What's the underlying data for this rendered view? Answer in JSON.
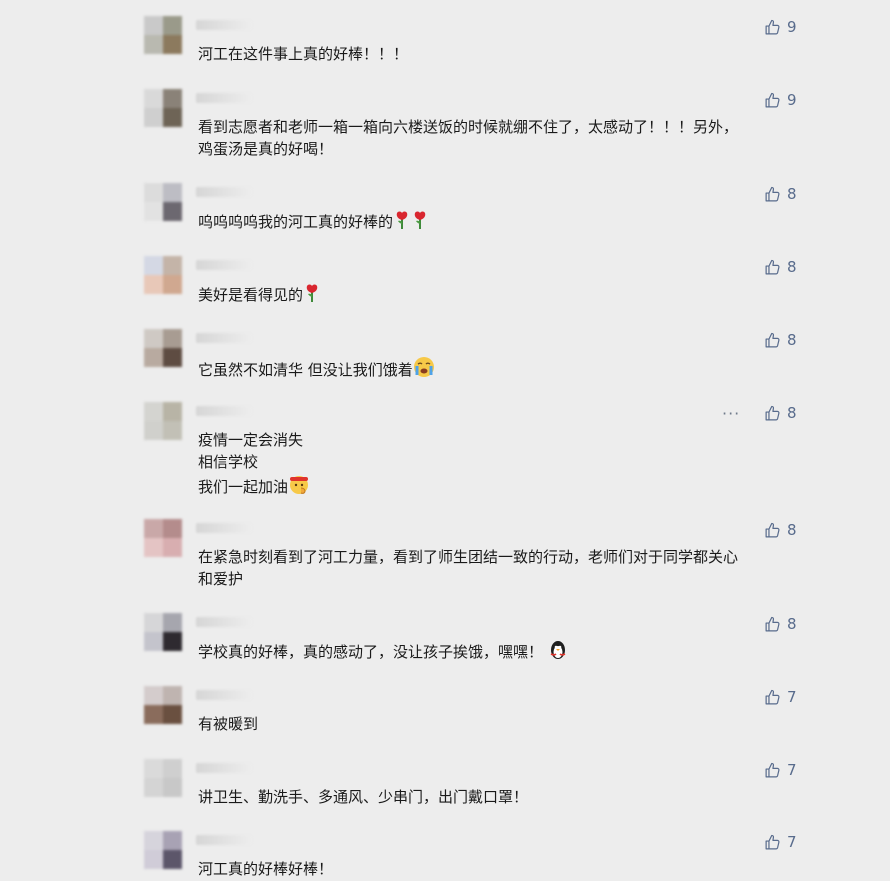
{
  "comments": [
    {
      "text": "河工在这件事上真的好棒！！！",
      "likes": "9",
      "emoji": []
    },
    {
      "text": "看到志愿者和老师一箱一箱向六楼送饭的时候就绷不住了，太感动了！！！另外，\n鸡蛋汤是真的好喝！",
      "likes": "9",
      "emoji": []
    },
    {
      "text": "呜呜呜呜我的河工真的好棒的",
      "likes": "8",
      "emoji": [
        "rose-emoji",
        "rose-emoji"
      ]
    },
    {
      "text": "美好是看得见的",
      "likes": "8",
      "emoji": [
        "rose-emoji"
      ]
    },
    {
      "text": "它虽然不如清华 但没让我们饿着",
      "likes": "8",
      "emoji": [
        "crying-emoji"
      ]
    },
    {
      "text": "疫情一定会消失\n相信学校\n我们一起加油",
      "likes": "8",
      "emoji": [
        "fighting-emoji"
      ]
    },
    {
      "text": "在紧急时刻看到了河工力量，看到了师生团结一致的行动，老师们对于同学都关心\n和爱护",
      "likes": "8",
      "emoji": []
    },
    {
      "text": "学校真的好棒，真的感动了，没让孩子挨饿，嘿嘿！",
      "likes": "8",
      "emoji": [
        "penguin-emoji"
      ]
    },
    {
      "text": "有被暖到",
      "likes": "7",
      "emoji": []
    },
    {
      "text": "讲卫生、勤洗手、多通风、少串门，出门戴口罩！",
      "likes": "7",
      "emoji": []
    },
    {
      "text": "河工真的好棒好棒！",
      "likes": "7",
      "emoji": []
    }
  ],
  "more_button": "···",
  "colors": {
    "background": "#ededed",
    "like": "#586b8c",
    "text": "#1a1a1a"
  }
}
